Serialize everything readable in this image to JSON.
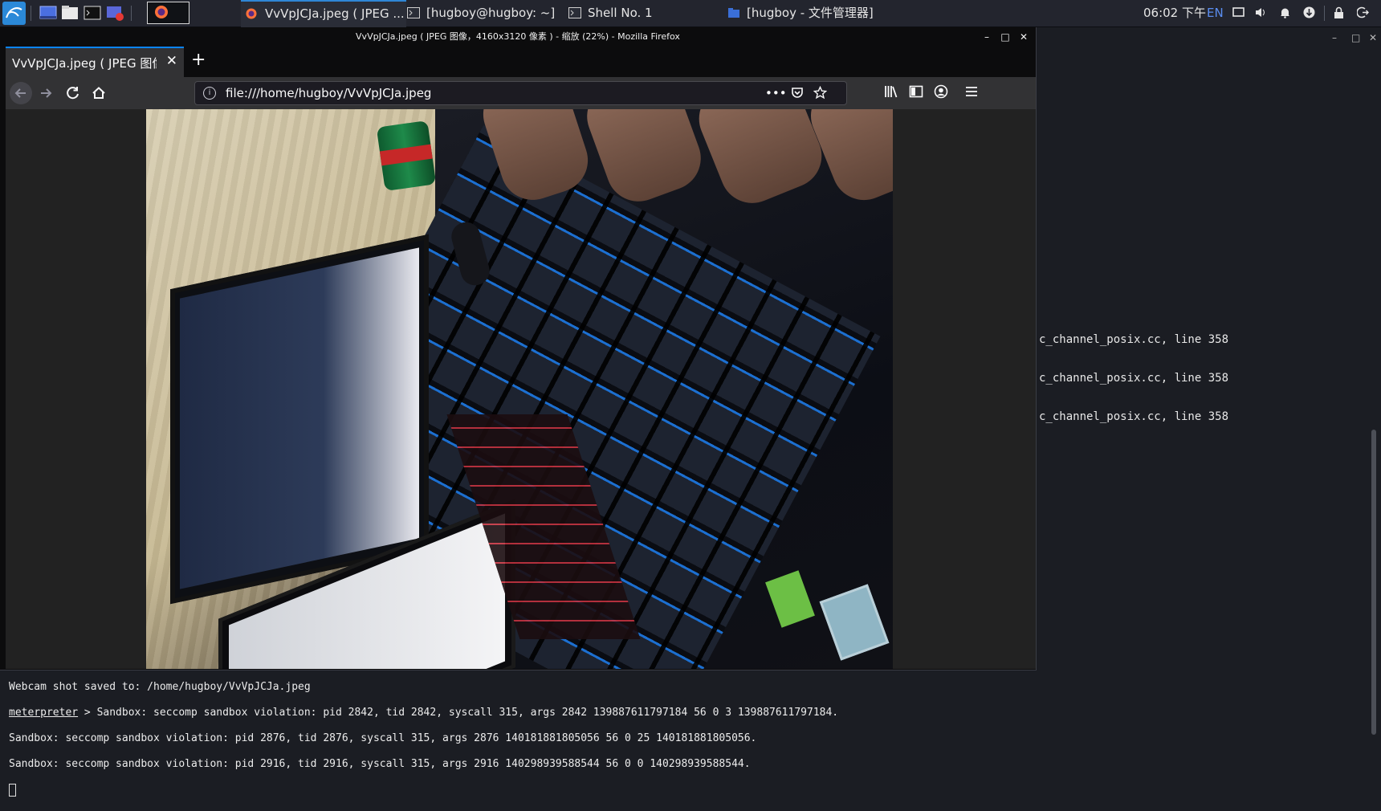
{
  "taskbar": {
    "tasks": [
      {
        "label": "VvVpJCJa.jpeg ( JPEG ...",
        "icon": "firefox-icon",
        "active": true
      },
      {
        "label": "[hugboy@hugboy: ~]",
        "icon": "terminal-icon",
        "active": false
      },
      {
        "label": "Shell No. 1",
        "icon": "terminal-icon",
        "active": false
      },
      {
        "label": "[hugboy - 文件管理器]",
        "icon": "folder-icon",
        "active": false
      }
    ],
    "clock": "06:02 下午",
    "language": "EN"
  },
  "firefox": {
    "window_title": "VvVpJCJa.jpeg ( JPEG 图像，4160x3120 像素 ) - 缩放 (22%) - Mozilla Firefox",
    "tab_title": "VvVpJCJa.jpeg ( JPEG 图像",
    "url": "file:///home/hugboy/VvVpJCJa.jpeg",
    "zoom": "22%"
  },
  "background_terminal": {
    "lines": [
      "c_channel_posix.cc, line 358",
      "c_channel_posix.cc, line 358",
      "c_channel_posix.cc, line 358"
    ]
  },
  "terminal_output": {
    "line0": "Webcam shot saved to: /home/hugboy/VvVpJCJa.jpeg",
    "prompt": "meterpreter",
    "line1_rest": " > Sandbox: seccomp sandbox violation: pid 2842, tid 2842, syscall 315, args 2842 139887611797184 56 0 3 139887611797184.",
    "line2": "Sandbox: seccomp sandbox violation: pid 2876, tid 2876, syscall 315, args 2876 140181881805056 56 0 25 140181881805056.",
    "line3": "Sandbox: seccomp sandbox violation: pid 2916, tid 2916, syscall 315, args 2916 140298939588544 56 0 0 140298939588544."
  },
  "colors": {
    "accent": "#0a84ff",
    "taskbar_bg": "#23252e",
    "terminal_bg": "#1b1d23"
  }
}
